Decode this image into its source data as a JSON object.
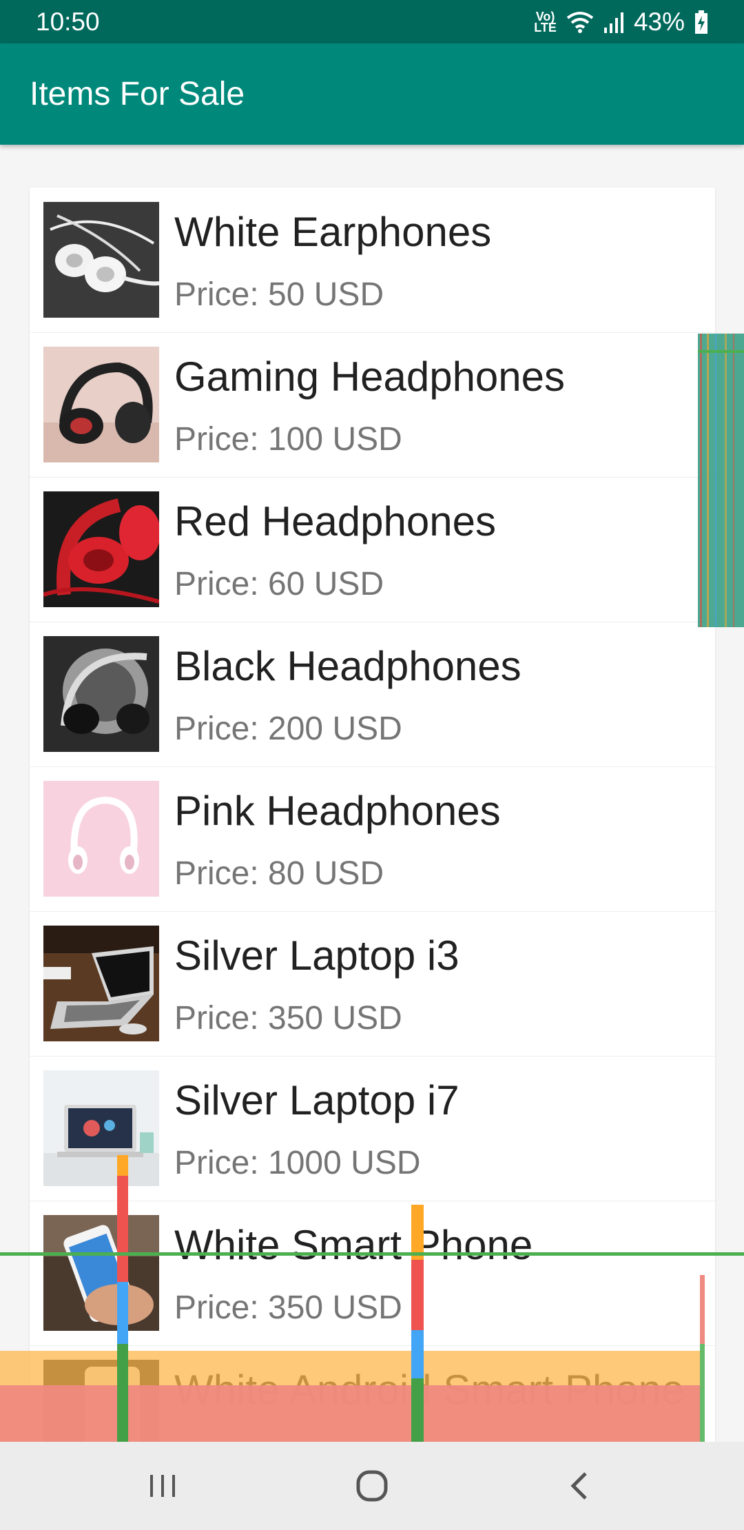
{
  "status_bar": {
    "time": "10:50",
    "volte_top": "Vo)",
    "volte_bottom": "LTE",
    "battery": "43%"
  },
  "app_bar": {
    "title": "Items For Sale",
    "color": "#00897b"
  },
  "items": [
    {
      "name": "White Earphones",
      "price": "Price: 50 USD",
      "thumb_icon": "earphones-photo"
    },
    {
      "name": "Gaming Headphones",
      "price": "Price: 100 USD",
      "thumb_icon": "headphones-photo"
    },
    {
      "name": "Red Headphones",
      "price": "Price: 60 USD",
      "thumb_icon": "headphones-photo"
    },
    {
      "name": "Black Headphones",
      "price": "Price: 200 USD",
      "thumb_icon": "headphones-photo"
    },
    {
      "name": "Pink Headphones",
      "price": "Price: 80 USD",
      "thumb_icon": "headphones-photo"
    },
    {
      "name": "Silver Laptop i3",
      "price": "Price: 350 USD",
      "thumb_icon": "laptop-photo"
    },
    {
      "name": "Silver Laptop i7",
      "price": "Price: 1000 USD",
      "thumb_icon": "laptop-photo"
    },
    {
      "name": "White Smart Phone",
      "price": "Price: 350 USD",
      "thumb_icon": "phone-photo"
    },
    {
      "name": "White Android Smart Phone",
      "price": "",
      "thumb_icon": "phone-photo"
    }
  ],
  "nav_bar": {
    "recents_icon": "recents-icon",
    "home_icon": "home-icon",
    "back_icon": "back-icon"
  }
}
